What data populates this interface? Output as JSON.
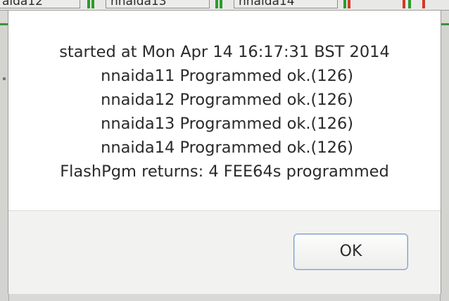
{
  "background": {
    "tabs": [
      "aida12",
      "nnaida13",
      "nnaida14"
    ]
  },
  "dialog": {
    "lines": [
      "started at Mon Apr 14 16:17:31 BST 2014",
      " nnaida11 Programmed ok.(126)",
      " nnaida12 Programmed ok.(126)",
      " nnaida13 Programmed ok.(126)",
      " nnaida14 Programmed ok.(126)",
      "FlashPgm returns: 4 FEE64s programmed"
    ],
    "ok_label": "OK"
  },
  "colors": {
    "accent_green": "#3f8f3b",
    "button_border": "#7d9ec7"
  }
}
